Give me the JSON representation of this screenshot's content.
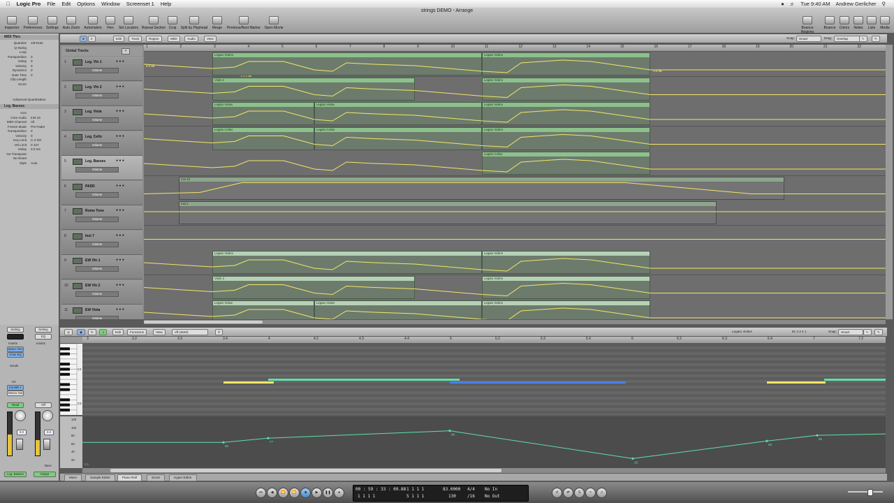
{
  "menubar": {
    "app": "Logic Pro",
    "items": [
      "File",
      "Edit",
      "Options",
      "Window",
      "Screenset 1",
      "Help"
    ],
    "time": "Tue 9:40 AM",
    "user": "Andrew Gerlicher"
  },
  "window_title": "strings DEMO - Arrange",
  "toolbar": {
    "buttons": [
      "Inspector",
      "Preferences",
      "Settings",
      "Auto Zoom",
      "Automation",
      "Flex",
      "Set Locators",
      "Repeat Section",
      "Crop",
      "Split by Playhead",
      "Merge",
      "Previous/Next Marker",
      "Open Movie"
    ],
    "right_buttons": [
      "Bounce Regions",
      "Bounce",
      "Colors",
      "Notes",
      "Lists",
      "Media"
    ]
  },
  "inspector": {
    "header": "MIDI Thru",
    "rows": [
      {
        "k": "Quantize",
        "v": "1/8-Note"
      },
      {
        "k": "Q-Swing",
        "v": ""
      },
      {
        "k": "Loop",
        "v": ""
      },
      {
        "k": "Transposition",
        "v": "0"
      },
      {
        "k": "Delay",
        "v": "0"
      },
      {
        "k": "Velocity",
        "v": "0"
      },
      {
        "k": "Dynamics",
        "v": "0"
      },
      {
        "k": "Gate Time",
        "v": "0"
      },
      {
        "k": "Clip Length",
        "v": ""
      },
      {
        "k": "Score",
        "v": ""
      }
    ],
    "adv": "Advanced Quantization",
    "track_header": "Leg. Basses",
    "track_rows": [
      {
        "k": "Icon",
        "v": ""
      },
      {
        "k": "Core Audio",
        "v": "Inst 16"
      },
      {
        "k": "MIDI Channel",
        "v": "All"
      },
      {
        "k": "Freeze Mode",
        "v": "Pre Fader"
      },
      {
        "k": "Transposition",
        "v": "0"
      },
      {
        "k": "Velocity",
        "v": "0"
      },
      {
        "k": "Key Limit",
        "v": "C-2 G8"
      },
      {
        "k": "Vel Limit",
        "v": "0 127"
      },
      {
        "k": "Delay",
        "v": "0.0 ms"
      },
      {
        "k": "No Transpose",
        "v": ""
      },
      {
        "k": "No Reset",
        "v": ""
      },
      {
        "k": "Style",
        "v": "Auto"
      }
    ]
  },
  "arrange": {
    "menus": [
      "Edit",
      "Track",
      "Region",
      "MIDI",
      "Audio",
      "View"
    ],
    "snap_label": "Snap:",
    "snap_value": "Smart",
    "drag_label": "Drag:",
    "drag_value": "Overlap",
    "global_tracks": "Global Tracks",
    "ruler": [
      "1",
      "2",
      "3",
      "4",
      "5",
      "6",
      "7",
      "8",
      "9",
      "10",
      "11",
      "12",
      "13",
      "14",
      "15",
      "16",
      "17",
      "18",
      "19",
      "20",
      "21",
      "22"
    ],
    "tracks": [
      {
        "num": "1",
        "name": "Leg. Vln 1",
        "param": "Volume"
      },
      {
        "num": "2",
        "name": "Leg. Vln 2",
        "param": "Volume"
      },
      {
        "num": "3",
        "name": "Leg. Viola",
        "param": "Volume"
      },
      {
        "num": "4",
        "name": "Leg. Cello",
        "param": "Volume"
      },
      {
        "num": "5",
        "name": "Leg. Basses",
        "param": "Volume"
      },
      {
        "num": "6",
        "name": "PADD",
        "param": "Volume"
      },
      {
        "num": "7",
        "name": "Rome Tone",
        "param": "Volume"
      },
      {
        "num": "8",
        "name": "Inst 7",
        "param": "Volume"
      },
      {
        "num": "9",
        "name": "EW Vln 1",
        "param": "Volume"
      },
      {
        "num": "10",
        "name": "EW Vln 2",
        "param": "Volume"
      },
      {
        "num": "11",
        "name": "EW Viola",
        "param": "Volume"
      }
    ],
    "regions": {
      "legato_violins": "Legato Violins",
      "violin2": "Violin 2",
      "legato_violas": "Legato Violas",
      "legato_cellos": "Legato Cellos",
      "inst19": "Inst 19",
      "inst2": "Inst 2"
    },
    "lane_start_db": [
      "0.0 dB",
      "-5.1 dB",
      "-2.9 dB",
      "0.0 dB",
      "0.0 dB",
      "-∞ dB",
      "-6.4 dB",
      "0.0 dB",
      "0.0 dB",
      "0.0 dB"
    ],
    "lane_end_db": [
      "-3.9 dB",
      "-10.5 dB",
      "-14.0 dB",
      "-8.5 dB",
      "-3.9 dB",
      "-∞ dB",
      "",
      "",
      "-11.5 dB",
      "-23.2 dB"
    ],
    "lane_mid_db": [
      "-12.4 dB",
      "-15.9",
      "-9.5 dB",
      "-3.3 dB",
      "-16.9 dB"
    ]
  },
  "piano_roll": {
    "menus": [
      "Edit",
      "Functions",
      "View"
    ],
    "param": "off (3840)",
    "region_name": "Legato Violins",
    "position": "81   3 2 4 1",
    "snap_label": "Snap:",
    "snap_value": "Smart",
    "ruler": [
      "3",
      "3.2",
      "3.3",
      "3.4",
      "4",
      "4.2",
      "4.3",
      "4.4",
      "5",
      "5.2",
      "5.3",
      "5.4",
      "6",
      "6.2",
      "6.3",
      "6.4",
      "7",
      "7.2"
    ],
    "key_labels": [
      "C4",
      "C3"
    ],
    "vel_axis": [
      "120",
      "100",
      "80",
      "60",
      "40",
      "20"
    ],
    "vel_labels": [
      "65",
      "77",
      "98",
      "19",
      "69",
      "85"
    ],
    "vel_values": [
      65,
      77,
      98,
      19,
      69,
      85
    ],
    "corner": "1  1"
  },
  "strips": {
    "setting": "Setting",
    "eq": "EQ",
    "inserts": "Inserts",
    "insert1": "Space Des",
    "insert2": "Chan EQ",
    "sends": "Sends",
    "io": "I/O",
    "input": "Kontakt 1",
    "output": "Stereo Out",
    "read": "Read",
    "off": "Off",
    "fader1": "0.0",
    "fader2": "0.0",
    "name1": "Leg. Basses",
    "name2": "Output",
    "bnce": "Bnce"
  },
  "bottom_tabs": [
    "Mixer",
    "Sample Editor",
    "Piano Roll",
    "Score",
    "Hyper Editor"
  ],
  "transport": {
    "smpte": "00 : 59 : 33 : 09.88",
    "smpte2": "1    1    1    1",
    "bars": "1   1   1   1",
    "bars2": "5   1   1   1",
    "tempo": "83.0000",
    "tempo2": "130",
    "sig": "4/4",
    "div": "/16",
    "in": "No In",
    "out": "No Out"
  },
  "colors": {
    "region": "#8cc08c",
    "automation": "#f2e766",
    "velocity": "#5fe0a8"
  }
}
